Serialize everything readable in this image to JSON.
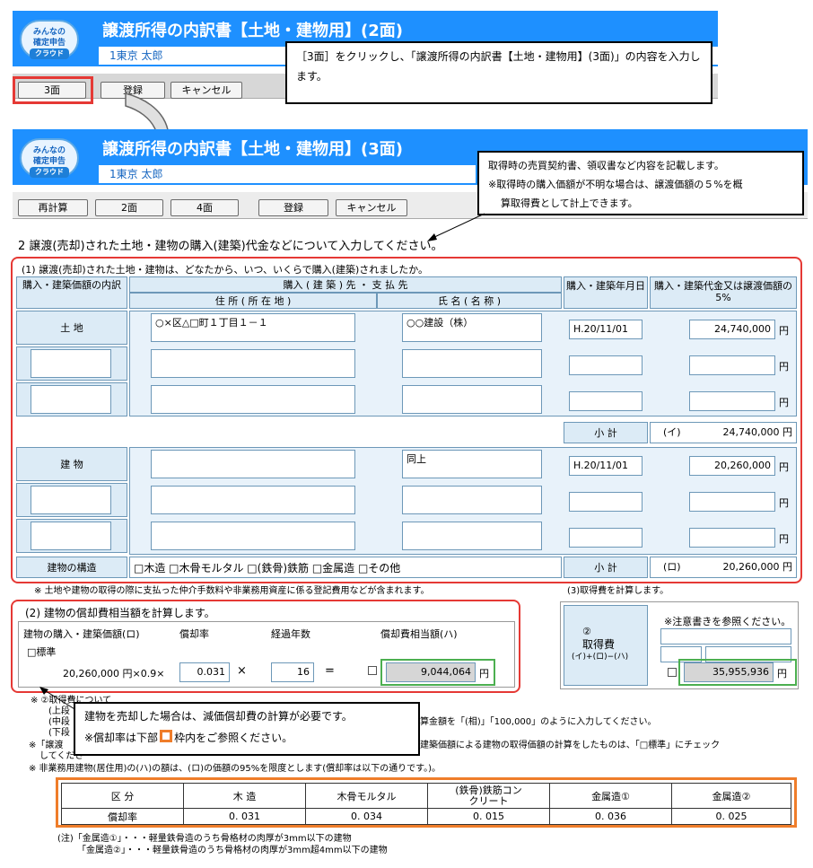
{
  "top": {
    "title": "譲渡所得の内訳書【土地・建物用】(2面)",
    "logo_line1": "みんなの",
    "logo_line2": "確定申告",
    "logo_line3": "クラウド",
    "user": "1東京 太郎",
    "buttons": [
      "3面",
      "登録",
      "キャンセル"
    ],
    "callout": "［3面］をクリックし、「譲渡所得の内訳書【土地・建物用】(3面)」の内容を入力します。"
  },
  "main": {
    "title": "譲渡所得の内訳書【土地・建物用】(3面)",
    "user": "1東京 太郎",
    "buttons": [
      "再計算",
      "2面",
      "4面",
      "登録",
      "キャンセル"
    ],
    "callout_line1": "取得時の売買契約書、領収書など内容を記載します。",
    "callout_line2": "※取得時の購入価額が不明な場合は、譲渡価額の５%を概",
    "callout_line3": "算取得費として計上できます。",
    "section_heading": "2  譲渡(売却)された土地・建物の購入(建築)代金などについて入力してください。",
    "q1": "(1)  譲渡(売却)された土地・建物は、どなたから、いつ、いくらで購入(建築)されましたか。",
    "col_breakdown": "購入・建築価額の内訳",
    "col_payee": "購入 ( 建 築 ) 先 ・ 支 払 先",
    "col_address": "住 所 ( 所 在 地 )",
    "col_name": "氏 名 ( 名 称 )",
    "col_date": "購入・建築年月日",
    "col_amount": "購入・建築代金又は譲渡価額の5%",
    "land_label": "土 地",
    "land_address": "○×区△□町１丁目１－１",
    "land_name": "○○建設（株）",
    "land_date": "H.20/11/01",
    "land_amount": "24,740,000",
    "yen": "円",
    "subtotal_label": "小 計",
    "subtotal_land_mark": "(イ)",
    "subtotal_land": "24,740,000 円",
    "building_label": "建 物",
    "building_name": "同上",
    "building_date": "H.20/11/01",
    "building_amount": "20,260,000",
    "structure_label": "建物の構造",
    "structures": "□木造 □木骨モルタル □(鉄骨)鉄筋 □金属造 □その他",
    "subtotal_bldg_mark": "(ロ)",
    "subtotal_bldg": "20,260,000 円",
    "note1": "※ 土地や建物の取得の際に支払った仲介手数料や非業務用資産に係る登記費用などが含まれます。",
    "q3": "(3)取得費を計算します。",
    "q2": "(2)  建物の償却費相当額を計算します。",
    "dep_col1": "建物の購入・建築価額(ロ)",
    "dep_col2": "償却率",
    "dep_col3": "経過年数",
    "dep_col4": "償却費相当額(ハ)",
    "standard": "□標準",
    "dep_base": "20,260,000 円×0.9×",
    "dep_rate": "0.031",
    "times": "×",
    "years": "16",
    "equals": "=",
    "dep_amount": "9,044,064",
    "acq_note": "※注意書きを参照ください。",
    "acq_label1": "②",
    "acq_label2": "取得費",
    "acq_formula": "(イ)+(ロ)−(ハ)",
    "acq_amount": "35,955,936",
    "callout2_line1": "建物を売却した場合は、減価償却費の計算が必要です。",
    "callout2_line2a": "※償却率は下部",
    "callout2_line2b": "枠内をご参照ください。",
    "notes_a": "※ ②取得費について",
    "notes_b": "(上段",
    "notes_c": "(中段",
    "notes_d": "(下段",
    "notes_e": "算金額を「(相)」「100,000」のように入力してください。",
    "notes_f": "※「譲渡",
    "notes_g": "建築価額による建物の取得価額の計算をしたものは、「□標準」にチェック",
    "notes_h": "してくださ",
    "notes_i": "※ 非業務用建物(居住用)の(ハ)の額は、(ロ)の価額の95%を限度とします(償却率は以下の通りです。)。",
    "rate_head": [
      "区 分",
      "木 造",
      "木骨モルタル",
      "(鉄骨)鉄筋コンクリート",
      "金属造①",
      "金属造②"
    ],
    "rate_row": [
      "償却率",
      "0. 031",
      "0. 034",
      "0. 015",
      "0. 036",
      "0. 025"
    ],
    "foot1": "(注)「金属造①」・・・軽量鉄骨造のうち骨格材の肉厚が3mm以下の建物",
    "foot2": "「金属造②」・・・軽量鉄骨造のうち骨格材の肉厚が3mm超4mm以下の建物"
  }
}
